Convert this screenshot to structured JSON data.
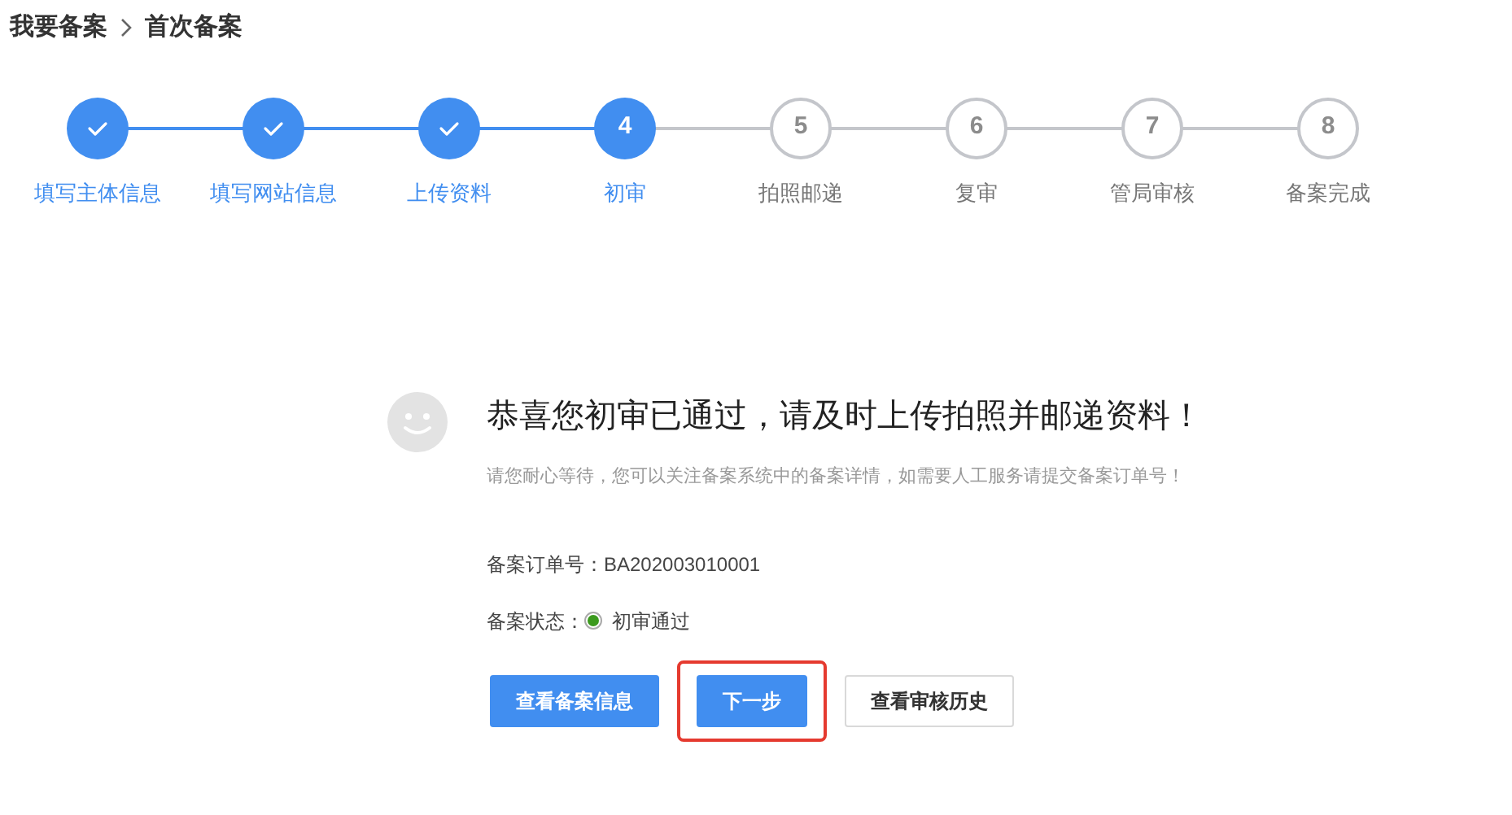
{
  "breadcrumb": [
    "我要备案",
    "首次备案"
  ],
  "steps": [
    {
      "label": "填写主体信息",
      "kind": "done"
    },
    {
      "label": "填写网站信息",
      "kind": "done"
    },
    {
      "label": "上传资料",
      "kind": "done"
    },
    {
      "number": "4",
      "label": "初审",
      "kind": "current"
    },
    {
      "number": "5",
      "label": "拍照邮递",
      "kind": "pending"
    },
    {
      "number": "6",
      "label": "复审",
      "kind": "pending"
    },
    {
      "number": "7",
      "label": "管局审核",
      "kind": "pending"
    },
    {
      "number": "8",
      "label": "备案完成",
      "kind": "pending"
    }
  ],
  "result": {
    "title": "恭喜您初审已通过，请及时上传拍照并邮递资料！",
    "subtitle": "请您耐心等待，您可以关注备案系统中的备案详情，如需要人工服务请提交备案订单号！",
    "order_label": "备案订单号：",
    "order_number": "BA202003010001",
    "status_label": "备案状态：",
    "status": "初审通过",
    "status_dot": {
      "color": "#3c9a1e"
    }
  },
  "buttons": [
    {
      "label": "查看备案信息",
      "kind": "primary",
      "highlighted": false
    },
    {
      "label": "下一步",
      "kind": "primary",
      "highlighted": true
    },
    {
      "label": "查看审核历史",
      "kind": "secondary",
      "highlighted": false
    }
  ]
}
